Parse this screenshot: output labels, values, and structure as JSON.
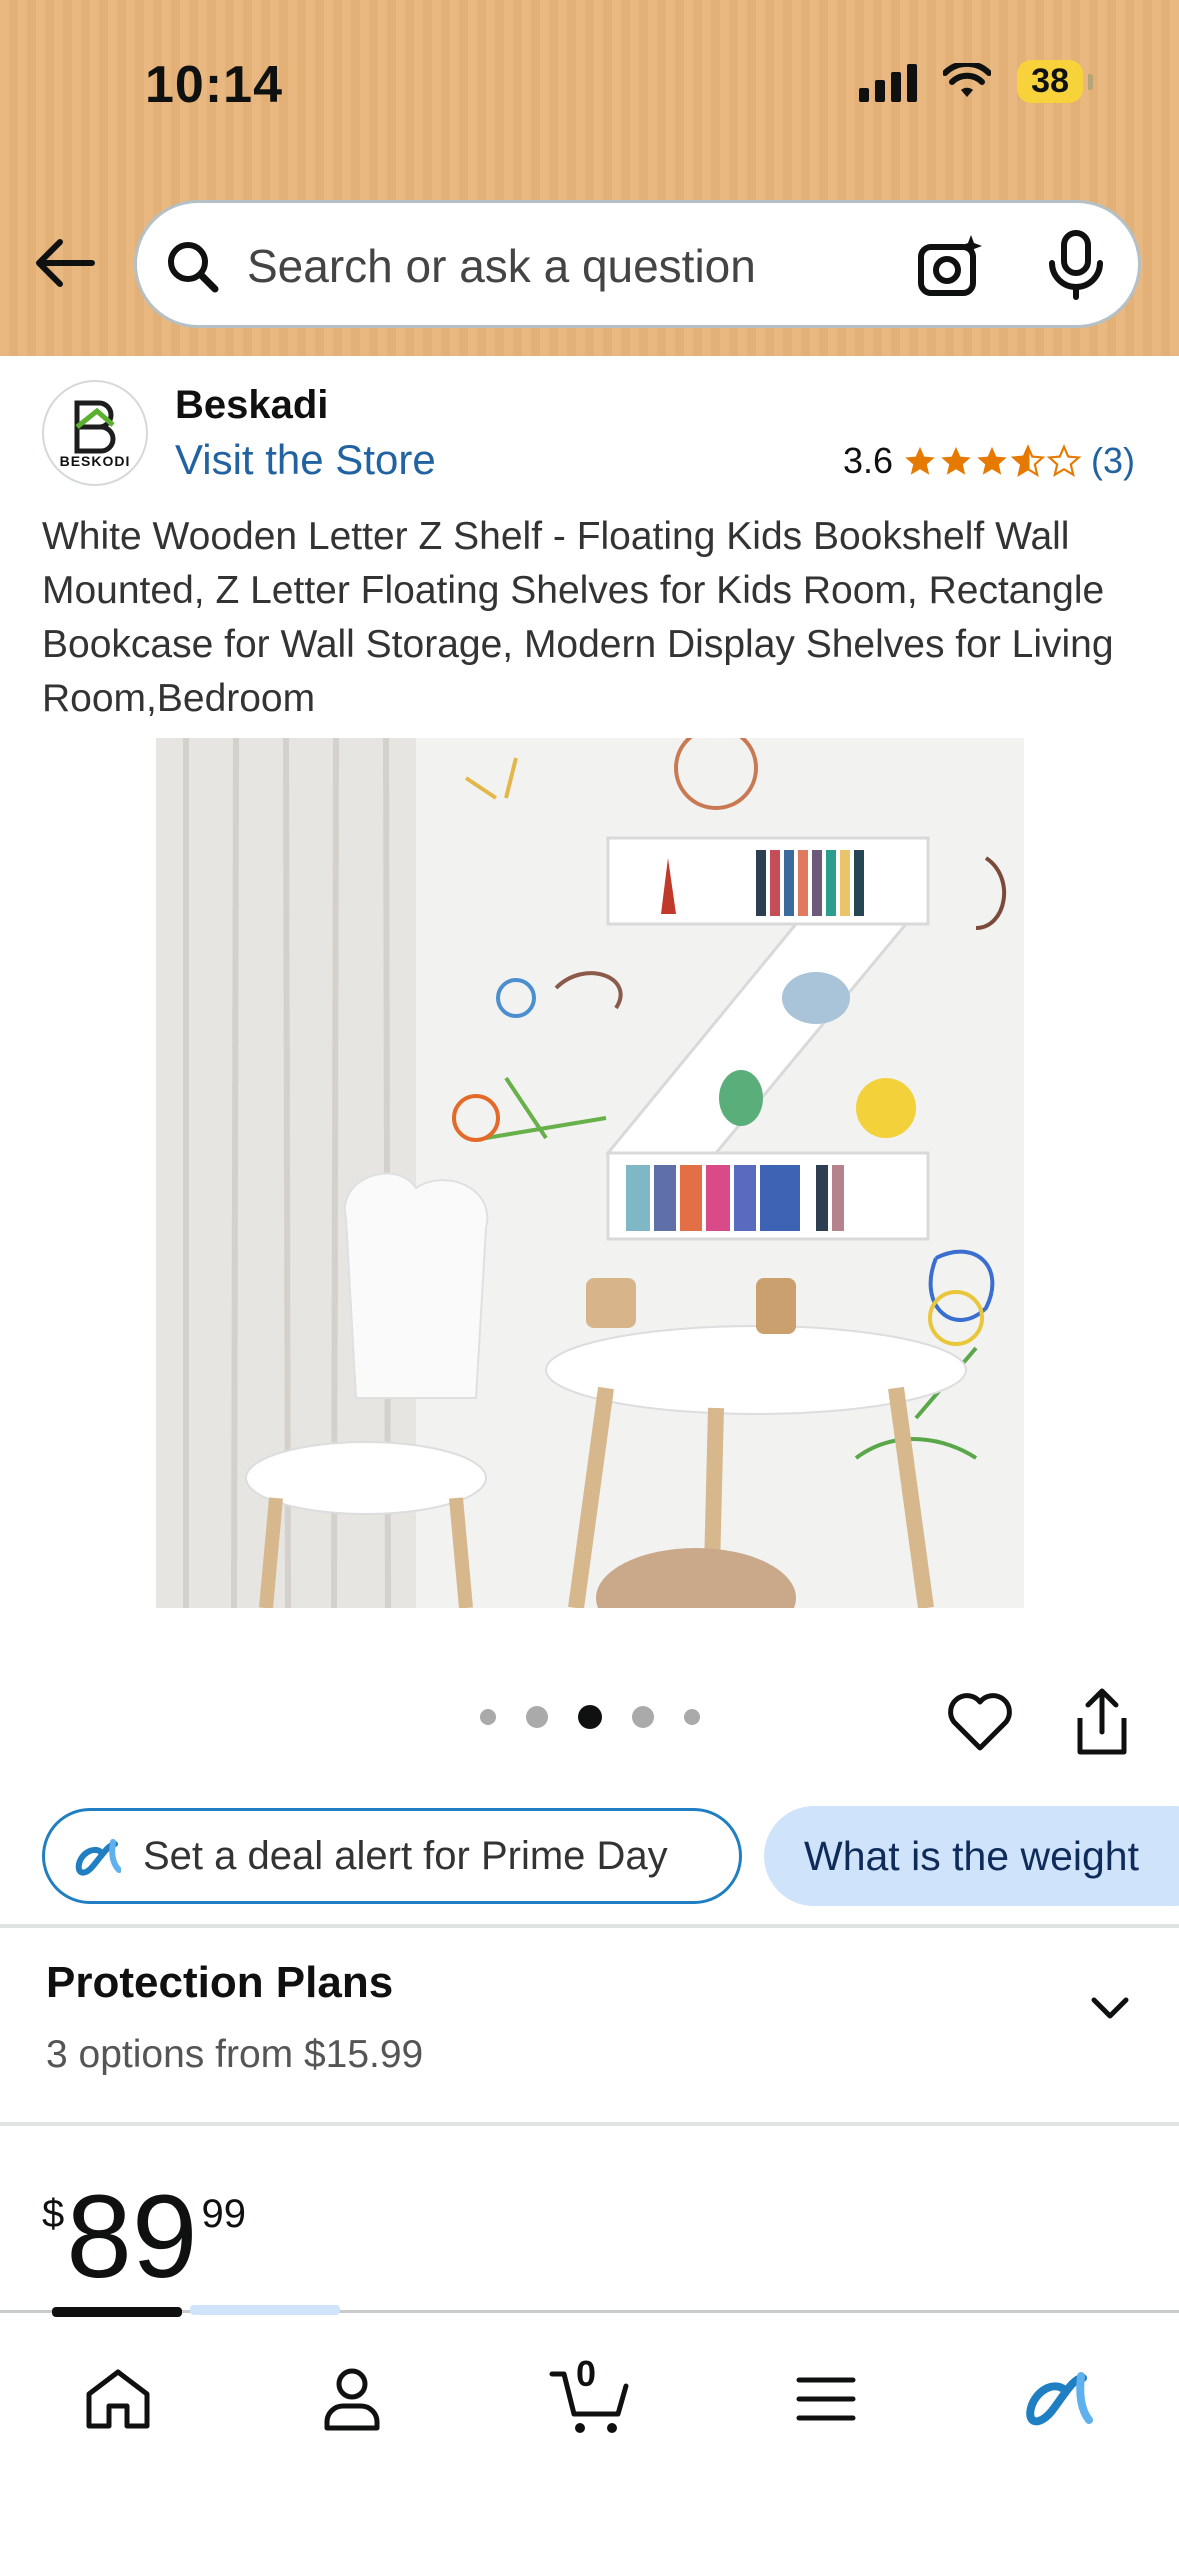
{
  "status_bar": {
    "time": "10:14",
    "battery": "38"
  },
  "search": {
    "placeholder": "Search or ask a question"
  },
  "brand": {
    "name": "Beskadi",
    "logo_text": "BESKODI",
    "visit_store": "Visit the Store"
  },
  "rating": {
    "value": "3.6",
    "stars": 3.6,
    "count": "(3)",
    "star_color": "#e67a00"
  },
  "product": {
    "title": "White Wooden Letter Z Shelf - Floating Kids Bookshelf Wall Mounted, Z Letter Floating Shelves for Kids Room, Rectangle Bookcase for Wall Storage, Modern Display Shelves for Living Room,Bedroom",
    "image_count": 5,
    "active_image_index": 2
  },
  "chips": {
    "deal_alert": "Set a deal alert for Prime Day",
    "question": "What is the weight"
  },
  "protection": {
    "title": "Protection Plans",
    "subtitle": "3 options from $15.99"
  },
  "price": {
    "symbol": "$",
    "whole": "89",
    "fraction": "99"
  },
  "bottom_nav": {
    "items": [
      "home-icon",
      "account-icon",
      "cart-icon",
      "menu-icon",
      "rufus-icon"
    ],
    "cart_count": "0"
  },
  "colors": {
    "header_bg": "#e9b880",
    "link": "#2162a1",
    "chip_border": "#1f7fc2",
    "chip_fill": "#cfe3fb"
  }
}
